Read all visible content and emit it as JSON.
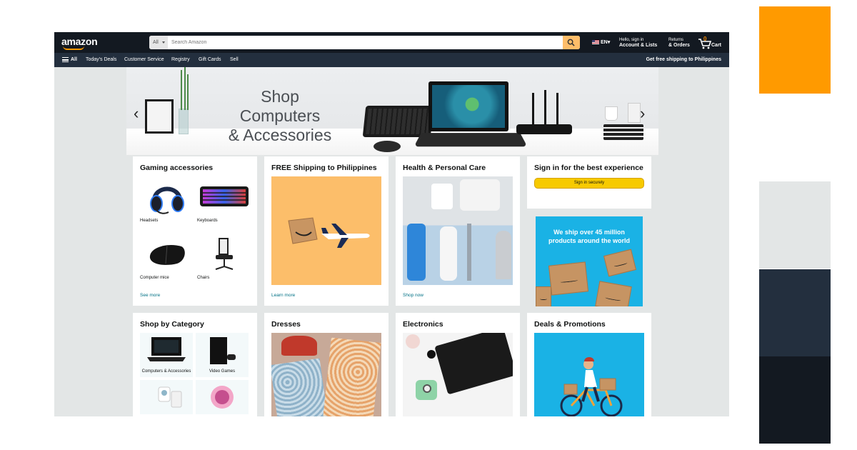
{
  "header": {
    "logo": "amazon",
    "search": {
      "department": "All",
      "placeholder": "Search Amazon"
    },
    "language": "EN",
    "account": {
      "greeting": "Hello, sign in",
      "label": "Account & Lists"
    },
    "orders": {
      "top": "Returns",
      "label": "& Orders"
    },
    "cart": {
      "count": "0",
      "label": "Cart"
    }
  },
  "subnav": {
    "all_label": "All",
    "items": [
      "Today's Deals",
      "Customer Service",
      "Registry",
      "Gift Cards",
      "Sell"
    ],
    "shipping_note": "Get free shipping to Philippines"
  },
  "hero": {
    "line1": "Shop Computers",
    "line2": "& Accessories"
  },
  "cards": {
    "gaming": {
      "title": "Gaming accessories",
      "tiles": [
        "Headsets",
        "Keyboards",
        "Computer mice",
        "Chairs"
      ],
      "link": "See more"
    },
    "shipping": {
      "title": "FREE Shipping to Philippines",
      "link": "Learn more"
    },
    "health": {
      "title": "Health & Personal Care",
      "link": "Shop now"
    },
    "signin": {
      "title": "Sign in for the best experience",
      "button": "Sign in securely"
    },
    "promo": {
      "text": "We ship over 45 million products around the world"
    },
    "category": {
      "title": "Shop by Category",
      "tiles": [
        "Computers & Accessories",
        "Video Games"
      ]
    },
    "dresses": {
      "title": "Dresses"
    },
    "electronics": {
      "title": "Electronics"
    },
    "deals": {
      "title": "Deals & Promotions"
    }
  },
  "colors": {
    "orange": "#ff9a00",
    "light_gray": "#e3e6e6",
    "navy": "#232f3e",
    "dark_navy": "#131921",
    "link": "#007185"
  }
}
